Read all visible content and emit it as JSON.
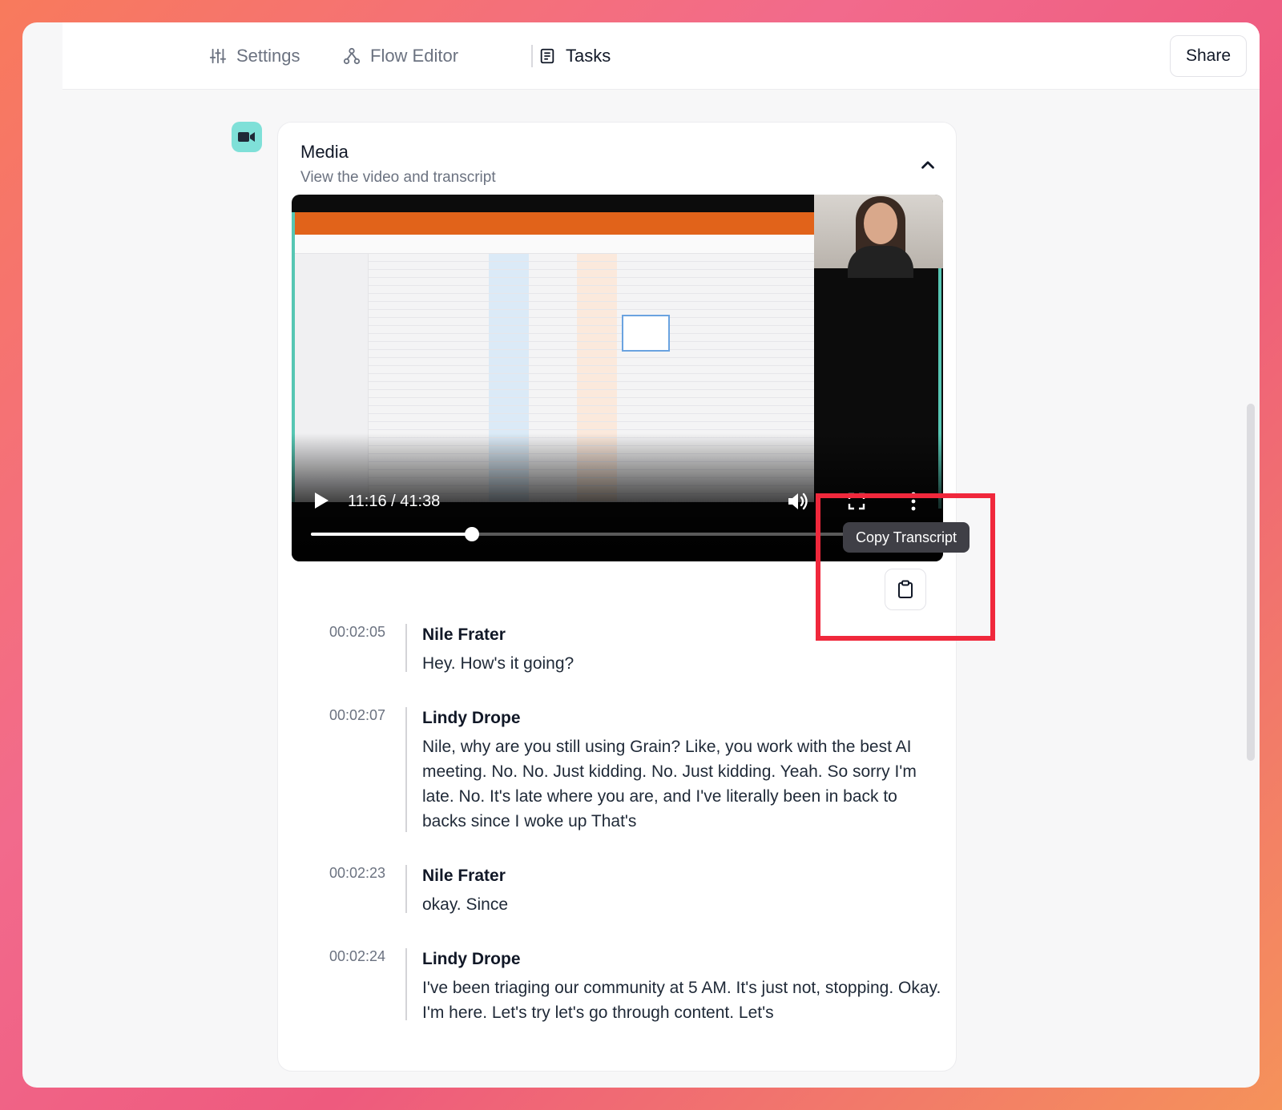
{
  "nav": {
    "settings_label": "Settings",
    "flow_editor_label": "Flow Editor",
    "tasks_label": "Tasks",
    "share_label": "Share"
  },
  "media": {
    "title": "Media",
    "subtitle": "View the video and transcript"
  },
  "video": {
    "timecode": "11:16 / 41:38",
    "progress": 0.272
  },
  "tooltip": "Copy Transcript",
  "transcript": [
    {
      "time": "00:02:05",
      "speaker": "Nile Frater",
      "text": "Hey. How's it going?"
    },
    {
      "time": "00:02:07",
      "speaker": "Lindy Drope",
      "text": "Nile, why are you still using Grain? Like, you work with the best AI meeting. No. No. Just kidding. No. Just kidding. Yeah. So sorry I'm late. No. It's late where you are, and I've literally been in back to backs since I woke up That's"
    },
    {
      "time": "00:02:23",
      "speaker": "Nile Frater",
      "text": "okay. Since"
    },
    {
      "time": "00:02:24",
      "speaker": "Lindy Drope",
      "text": "I've been triaging our community at 5 AM. It's just not, stopping. Okay. I'm here. Let's try let's go through content. Let's"
    }
  ],
  "colors": {
    "highlight": "#f0283c",
    "media_icon_bg": "#7fe0d8",
    "tooltip_bg": "#3f3f46"
  },
  "icons": [
    "sliders-icon",
    "flow-icon",
    "tasks-icon",
    "video-camera-icon",
    "chevron-up-icon",
    "play-icon",
    "volume-icon",
    "fullscreen-icon",
    "more-vertical-icon",
    "clipboard-icon"
  ]
}
